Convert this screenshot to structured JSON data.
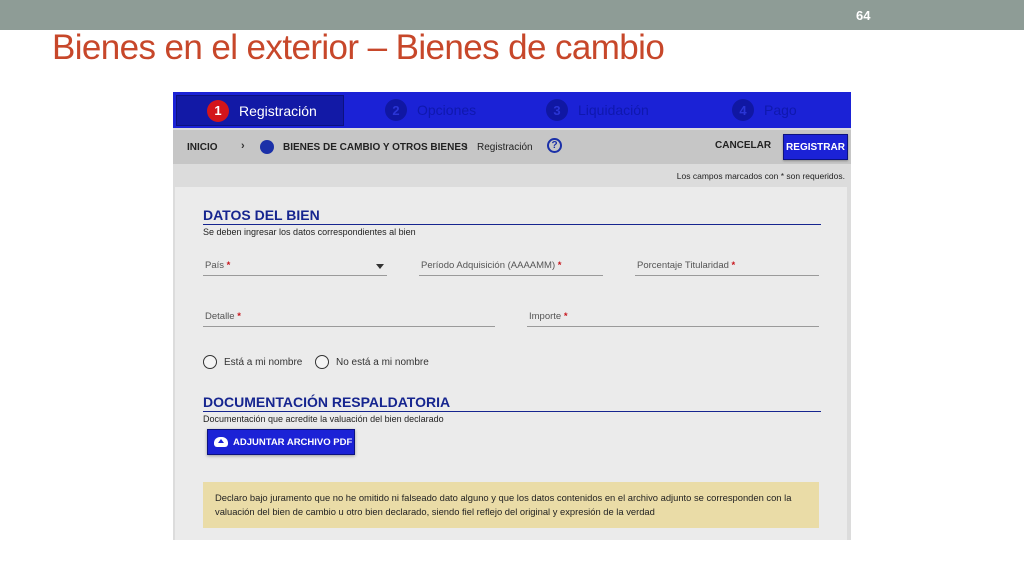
{
  "slide": {
    "number": "64",
    "title": "Bienes en el exterior – Bienes de cambio"
  },
  "stepper": {
    "steps": [
      {
        "num": "1",
        "label": "Registración"
      },
      {
        "num": "2",
        "label": "Opciones"
      },
      {
        "num": "3",
        "label": "Liquidación"
      },
      {
        "num": "4",
        "label": "Pago"
      }
    ]
  },
  "breadcrumb": {
    "home": "INICIO",
    "section": "BIENES DE CAMBIO Y OTROS BIENES",
    "current": "Registración",
    "separator": "›",
    "help": "?"
  },
  "actions": {
    "cancel": "CANCELAR",
    "register": "REGISTRAR"
  },
  "required_note": "Los campos marcados con * son requeridos.",
  "datos": {
    "title": "DATOS DEL BIEN",
    "subtitle": "Se deben ingresar los datos correspondientes al bien",
    "fields": {
      "pais": "País",
      "periodo": "Período Adquisición (AAAAMM)",
      "porcentaje": "Porcentaje Titularidad",
      "detalle": "Detalle",
      "importe": "Importe"
    },
    "required_mark": "*",
    "radios": {
      "a_mi_nombre": "Está a mi nombre",
      "no_a_mi_nombre": "No está a mi nombre"
    }
  },
  "documentacion": {
    "title": "DOCUMENTACIÓN RESPALDATORIA",
    "subtitle": "Documentación que acredite la valuación del bien declarado",
    "attach_button": "ADJUNTAR ARCHIVO PDF"
  },
  "declaration": "Declaro bajo juramento que no he omitido ni falseado dato alguno y que los datos contenidos en el archivo adjunto se corresponden con la valuación del bien de cambio u otro bien declarado, siendo fiel reflejo del original y expresión de la verdad",
  "colors": {
    "accent": "#1b22d6",
    "title": "#c7472a",
    "required": "#c8161d",
    "declaration_bg": "#eadca7"
  }
}
